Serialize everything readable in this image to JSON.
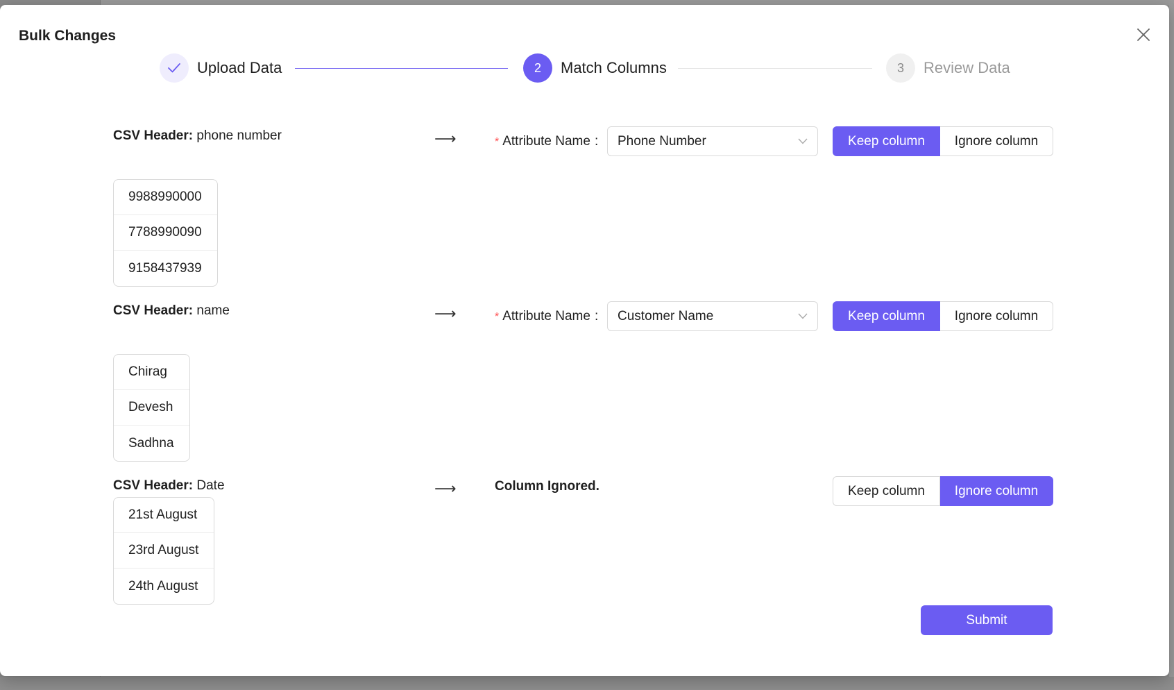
{
  "modal": {
    "title": "Bulk Changes",
    "close_icon": "close-icon"
  },
  "steps": [
    {
      "number": "",
      "label": "Upload Data",
      "status": "finished",
      "icon": "check-icon"
    },
    {
      "number": "2",
      "label": "Match Columns",
      "status": "active"
    },
    {
      "number": "3",
      "label": "Review Data",
      "status": "pending"
    }
  ],
  "rows": [
    {
      "csv_header_prefix": "CSV Header:",
      "csv_header": "phone number",
      "arrow": "⟶",
      "attribute_label": "Attribute Name",
      "attribute_colon": ":",
      "attribute_value": "Phone Number",
      "keep_label": "Keep column",
      "ignore_label": "Ignore column",
      "selected": "keep",
      "samples": [
        "9988990000",
        "7788990090",
        "9158437939"
      ]
    },
    {
      "csv_header_prefix": "CSV Header:",
      "csv_header": "name",
      "arrow": "⟶",
      "attribute_label": "Attribute Name",
      "attribute_colon": ":",
      "attribute_value": "Customer Name",
      "keep_label": "Keep column",
      "ignore_label": "Ignore column",
      "selected": "keep",
      "samples": [
        "Chirag",
        "Devesh",
        "Sadhna"
      ]
    },
    {
      "csv_header_prefix": "CSV Header:",
      "csv_header": "Date",
      "arrow": "⟶",
      "ignored_text": "Column Ignored.",
      "keep_label": "Keep column",
      "ignore_label": "Ignore column",
      "selected": "ignore",
      "samples": [
        "21st August",
        "23rd August",
        "24th August"
      ]
    }
  ],
  "submit_label": "Submit",
  "colors": {
    "primary": "#6b5cf2",
    "required": "#ff4d4f"
  }
}
